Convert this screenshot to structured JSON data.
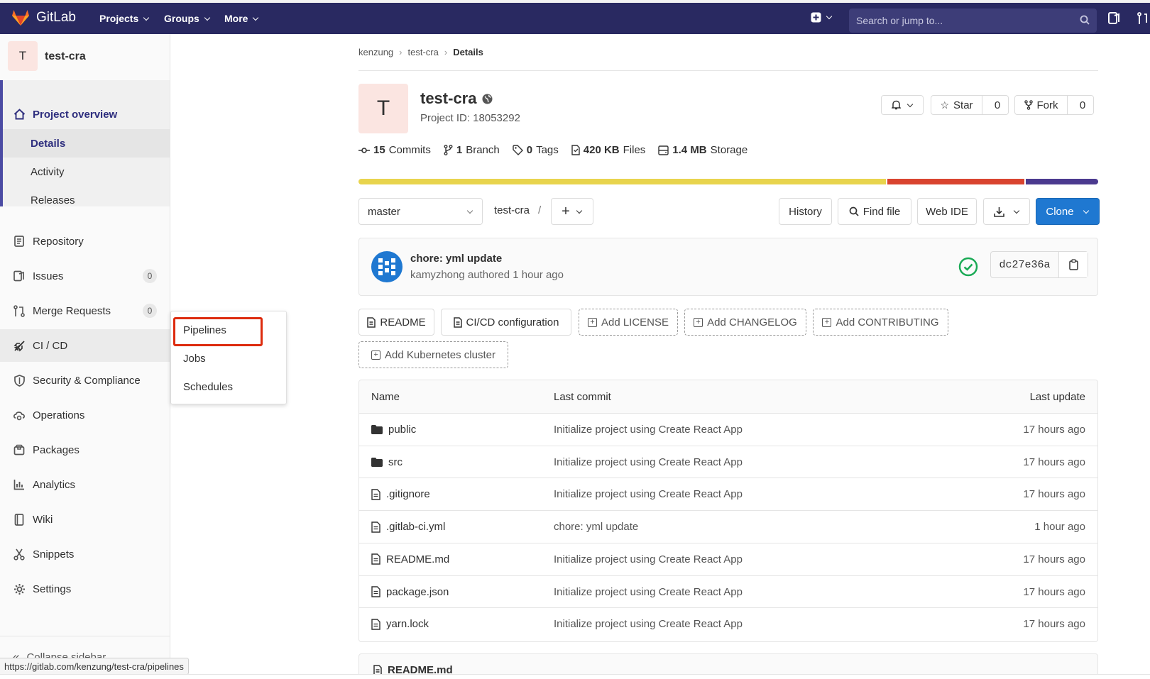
{
  "topbar": {
    "brand": "GitLab",
    "menus": [
      "Projects",
      "Groups",
      "More"
    ],
    "search_placeholder": "Search or jump to..."
  },
  "sidebar": {
    "project_initial": "T",
    "project_name": "test-cra",
    "overview": {
      "label": "Project overview",
      "sub": [
        "Details",
        "Activity",
        "Releases"
      ]
    },
    "items": [
      {
        "label": "Repository",
        "icon": "repository-icon"
      },
      {
        "label": "Issues",
        "icon": "issues-icon",
        "count": "0"
      },
      {
        "label": "Merge Requests",
        "icon": "merge-request-icon",
        "count": "0"
      },
      {
        "label": "CI / CD",
        "icon": "rocket-icon"
      },
      {
        "label": "Security & Compliance",
        "icon": "shield-icon"
      },
      {
        "label": "Operations",
        "icon": "cloud-gear-icon"
      },
      {
        "label": "Packages",
        "icon": "package-icon"
      },
      {
        "label": "Analytics",
        "icon": "chart-icon"
      },
      {
        "label": "Wiki",
        "icon": "book-icon"
      },
      {
        "label": "Snippets",
        "icon": "scissors-icon"
      },
      {
        "label": "Settings",
        "icon": "gear-icon"
      }
    ],
    "collapse_label": "Collapse sidebar"
  },
  "flyout": {
    "items": [
      "Pipelines",
      "Jobs",
      "Schedules"
    ],
    "highlighted": "Pipelines"
  },
  "breadcrumb": [
    "kenzung",
    "test-cra",
    "Details"
  ],
  "project": {
    "initial": "T",
    "name": "test-cra",
    "id_text": "Project ID: 18053292",
    "star_label": "Star",
    "star_count": "0",
    "fork_label": "Fork",
    "fork_count": "0"
  },
  "stats": [
    {
      "value": "15",
      "label": "Commits"
    },
    {
      "value": "1",
      "label": "Branch"
    },
    {
      "value": "0",
      "label": "Tags"
    },
    {
      "value": "420 KB",
      "label": "Files"
    },
    {
      "value": "1.4 MB",
      "label": "Storage"
    }
  ],
  "language_bar": [
    {
      "fraction": 0.716,
      "color": "#e8d44d"
    },
    {
      "fraction": 0.186,
      "color": "#d9442f"
    },
    {
      "fraction": 0.098,
      "color": "#4b3a8f"
    }
  ],
  "toolbar": {
    "branch": "master",
    "path": "test-cra",
    "separator": "/",
    "history": "History",
    "find_file": "Find file",
    "web_ide": "Web IDE",
    "clone": "Clone"
  },
  "last_commit": {
    "message": "chore: yml update",
    "meta": "kamyzhong authored 1 hour ago",
    "sha": "dc27e36a",
    "status_color": "#1aaa55"
  },
  "shortcuts": {
    "readme": "README",
    "cicd": "CI/CD configuration",
    "add_license": "Add LICENSE",
    "add_changelog": "Add CHANGELOG",
    "add_contributing": "Add CONTRIBUTING",
    "add_k8s": "Add Kubernetes cluster"
  },
  "files": {
    "headers": [
      "Name",
      "Last commit",
      "Last update"
    ],
    "rows": [
      {
        "name": "public",
        "type": "folder",
        "commit": "Initialize project using Create React App",
        "updated": "17 hours ago"
      },
      {
        "name": "src",
        "type": "folder",
        "commit": "Initialize project using Create React App",
        "updated": "17 hours ago"
      },
      {
        "name": ".gitignore",
        "type": "file",
        "commit": "Initialize project using Create React App",
        "updated": "17 hours ago"
      },
      {
        "name": ".gitlab-ci.yml",
        "type": "file",
        "commit": "chore: yml update",
        "updated": "1 hour ago"
      },
      {
        "name": "README.md",
        "type": "file",
        "commit": "Initialize project using Create React App",
        "updated": "17 hours ago"
      },
      {
        "name": "package.json",
        "type": "file",
        "commit": "Initialize project using Create React App",
        "updated": "17 hours ago"
      },
      {
        "name": "yarn.lock",
        "type": "file",
        "commit": "Initialize project using Create React App",
        "updated": "17 hours ago"
      }
    ]
  },
  "readme_title": "README.md",
  "status_url": "https://gitlab.com/kenzung/test-cra/pipelines",
  "colors": {
    "nav_bg": "#292961",
    "accent": "#1f78d1",
    "highlight_box": "#dd2b0e"
  }
}
